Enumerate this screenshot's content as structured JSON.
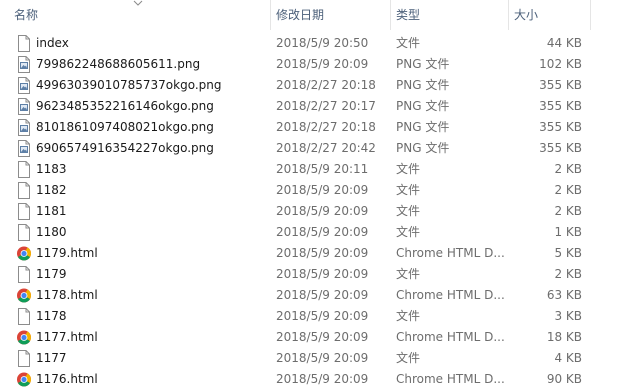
{
  "columns": {
    "name": "名称",
    "date": "修改日期",
    "type": "类型",
    "size": "大小"
  },
  "files": [
    {
      "name": "index",
      "date": "2018/5/9 20:50",
      "type": "文件",
      "size": "44 KB",
      "icon": "file-icon"
    },
    {
      "name": "799862248688605611.png",
      "date": "2018/5/9 20:09",
      "type": "PNG 文件",
      "size": "102 KB",
      "icon": "image-file-icon"
    },
    {
      "name": "49963039010785737okgo.png",
      "date": "2018/2/27 20:18",
      "type": "PNG 文件",
      "size": "355 KB",
      "icon": "image-file-icon"
    },
    {
      "name": "9623485352216146okgo.png",
      "date": "2018/2/27 20:17",
      "type": "PNG 文件",
      "size": "355 KB",
      "icon": "image-file-icon"
    },
    {
      "name": "8101861097408021okgo.png",
      "date": "2018/2/27 20:18",
      "type": "PNG 文件",
      "size": "355 KB",
      "icon": "image-file-icon"
    },
    {
      "name": "6906574916354227okgo.png",
      "date": "2018/2/27 20:42",
      "type": "PNG 文件",
      "size": "355 KB",
      "icon": "image-file-icon"
    },
    {
      "name": "1183",
      "date": "2018/5/9 20:11",
      "type": "文件",
      "size": "2 KB",
      "icon": "file-icon"
    },
    {
      "name": "1182",
      "date": "2018/5/9 20:09",
      "type": "文件",
      "size": "2 KB",
      "icon": "file-icon"
    },
    {
      "name": "1181",
      "date": "2018/5/9 20:09",
      "type": "文件",
      "size": "2 KB",
      "icon": "file-icon"
    },
    {
      "name": "1180",
      "date": "2018/5/9 20:09",
      "type": "文件",
      "size": "1 KB",
      "icon": "file-icon"
    },
    {
      "name": "1179.html",
      "date": "2018/5/9 20:09",
      "type": "Chrome HTML D...",
      "size": "5 KB",
      "icon": "chrome-icon"
    },
    {
      "name": "1179",
      "date": "2018/5/9 20:09",
      "type": "文件",
      "size": "2 KB",
      "icon": "file-icon"
    },
    {
      "name": "1178.html",
      "date": "2018/5/9 20:09",
      "type": "Chrome HTML D...",
      "size": "63 KB",
      "icon": "chrome-icon"
    },
    {
      "name": "1178",
      "date": "2018/5/9 20:09",
      "type": "文件",
      "size": "3 KB",
      "icon": "file-icon"
    },
    {
      "name": "1177.html",
      "date": "2018/5/9 20:09",
      "type": "Chrome HTML D...",
      "size": "18 KB",
      "icon": "chrome-icon"
    },
    {
      "name": "1177",
      "date": "2018/5/9 20:09",
      "type": "文件",
      "size": "4 KB",
      "icon": "file-icon"
    },
    {
      "name": "1176.html",
      "date": "2018/5/9 20:09",
      "type": "Chrome HTML D...",
      "size": "90 KB",
      "icon": "chrome-icon"
    }
  ]
}
